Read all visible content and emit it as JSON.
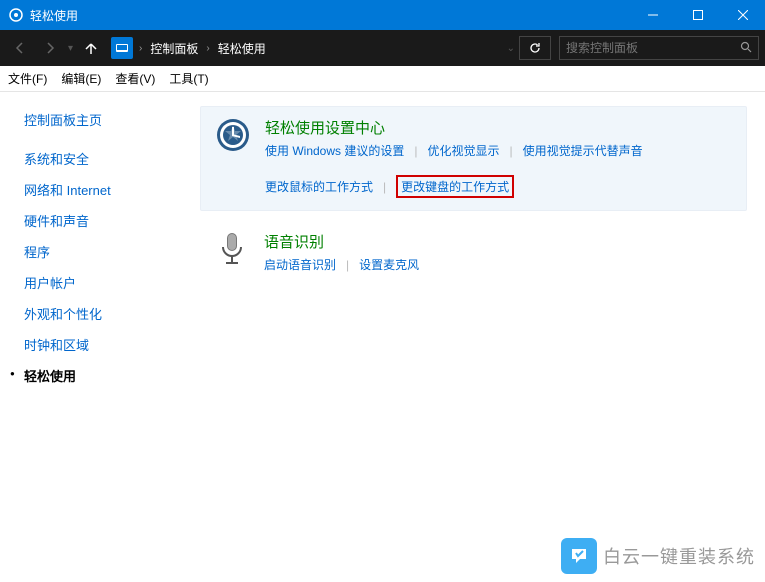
{
  "window": {
    "title": "轻松使用"
  },
  "breadcrumb": {
    "item1": "控制面板",
    "item2": "轻松使用"
  },
  "search": {
    "placeholder": "搜索控制面板"
  },
  "menu": {
    "file": "文件(F)",
    "edit": "编辑(E)",
    "view": "查看(V)",
    "tools": "工具(T)"
  },
  "sidebar": {
    "home": "控制面板主页",
    "items": [
      "系统和安全",
      "网络和 Internet",
      "硬件和声音",
      "程序",
      "用户帐户",
      "外观和个性化",
      "时钟和区域",
      "轻松使用"
    ]
  },
  "cards": {
    "ease": {
      "title": "轻松使用设置中心",
      "links": {
        "a": "使用 Windows 建议的设置",
        "b": "优化视觉显示",
        "c": "使用视觉提示代替声音",
        "d": "更改鼠标的工作方式",
        "e": "更改键盘的工作方式"
      }
    },
    "speech": {
      "title": "语音识别",
      "links": {
        "a": "启动语音识别",
        "b": "设置麦克风"
      }
    }
  },
  "watermark": "白云一键重装系统"
}
